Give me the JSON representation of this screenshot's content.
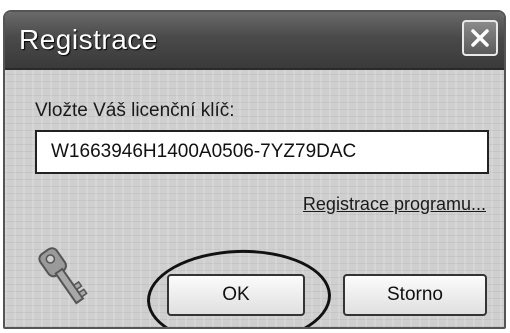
{
  "window": {
    "title": "Registrace",
    "close_icon": "close-icon"
  },
  "form": {
    "prompt_label": "Vložte Váš licenční klíč:",
    "license_key_value": "W1663946H1400A0506-7YZ79DAC",
    "register_link": "Registrace programu..."
  },
  "buttons": {
    "ok_label": "OK",
    "cancel_label": "Storno"
  },
  "decorations": {
    "key_icon": "key-icon",
    "highlight": "ok-button-highlight-ellipse"
  }
}
